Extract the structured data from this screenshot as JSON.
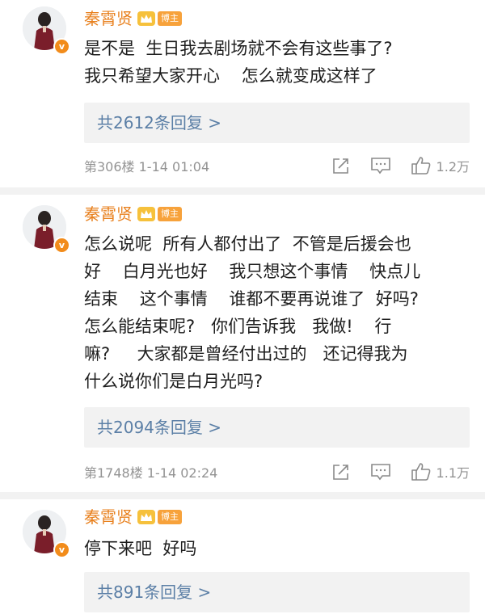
{
  "comments": [
    {
      "author": "秦霄贤",
      "tag": "博主",
      "lines": [
        "是不是  生日我去剧场就不会有这些事了?",
        "我只希望大家开心    怎么就变成这样了"
      ],
      "reply_link": "共2612条回复 >",
      "floor_time": "第306楼 1-14 01:04",
      "likes": "1.2万"
    },
    {
      "author": "秦霄贤",
      "tag": "博主",
      "lines": [
        "怎么说呢  所有人都付出了  不管是后援会也",
        "好    白月光也好    我只想这个事情    快点儿",
        "结束    这个事情    谁都不要再说谁了  好吗?",
        "怎么能结束呢?   你们告诉我   我做!    行",
        "嘛?     大家都是曾经付出过的   还记得我为",
        "什么说你们是白月光吗?"
      ],
      "reply_link": "共2094条回复 >",
      "floor_time": "第1748楼 1-14 02:24",
      "likes": "1.1万"
    },
    {
      "author": "秦霄贤",
      "tag": "博主",
      "lines": [
        "停下来吧  好吗"
      ],
      "reply_link": "共891条回复 >"
    }
  ],
  "colors": {
    "name": "#e8811f",
    "link": "#5b7fa6",
    "meta": "#939393",
    "badge": "#f28c1b"
  },
  "icons": [
    "avatar",
    "verified-v-badge",
    "crown-icon",
    "share-icon",
    "comment-icon",
    "like-icon"
  ]
}
